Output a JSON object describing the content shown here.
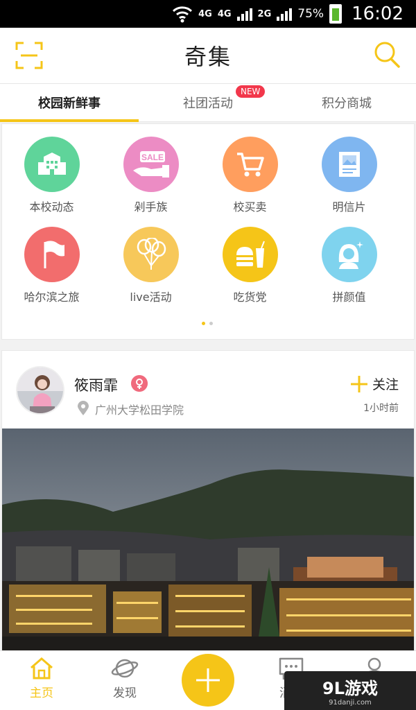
{
  "status_bar": {
    "net1": "4G",
    "net2": "4G",
    "net3": "2G",
    "battery": "75%",
    "time": "16:02"
  },
  "header": {
    "title": "奇集",
    "left_icon": "scan-icon",
    "right_icon": "search-icon"
  },
  "tabs": [
    {
      "label": "校园新鲜事",
      "active": true
    },
    {
      "label": "社团活动",
      "badge": "NEW"
    },
    {
      "label": "积分商城"
    }
  ],
  "categories": [
    {
      "label": "本校动态",
      "icon": "school-building-icon",
      "color": "#5fd49a"
    },
    {
      "label": "剁手族",
      "icon": "sale-hand-icon",
      "color": "#ec8cc4",
      "icon_text": "SALE"
    },
    {
      "label": "校买卖",
      "icon": "shopping-cart-icon",
      "color": "#ff9e5e"
    },
    {
      "label": "明信片",
      "icon": "postcard-icon",
      "color": "#7fb6f0"
    },
    {
      "label": "哈尔滨之旅",
      "icon": "flag-icon",
      "color": "#f26d6d"
    },
    {
      "label": "live活动",
      "icon": "balloons-icon",
      "color": "#f7c85a"
    },
    {
      "label": "吃货党",
      "icon": "burger-drink-icon",
      "color": "#f5c518"
    },
    {
      "label": "拼颜值",
      "icon": "girl-avatar-icon",
      "color": "#7fd3ee"
    }
  ],
  "pager": {
    "pages": 2,
    "current": 1
  },
  "post": {
    "username": "筱雨霏",
    "gender": "female",
    "location": "广州大学松田学院",
    "follow_label": "关注",
    "time_ago": "1小时前"
  },
  "bottom_nav": [
    {
      "label": "主页",
      "icon": "home-icon",
      "active": true
    },
    {
      "label": "发现",
      "icon": "planet-icon"
    },
    {
      "label": "",
      "icon": "plus-icon"
    },
    {
      "label": "消息",
      "icon": "chat-bubble-icon"
    },
    {
      "label": "",
      "icon": "person-icon"
    }
  ],
  "watermark": {
    "main": "9L游戏",
    "sub": "91danji.com"
  },
  "colors": {
    "accent": "#f5c518",
    "badge": "#f2374b"
  }
}
